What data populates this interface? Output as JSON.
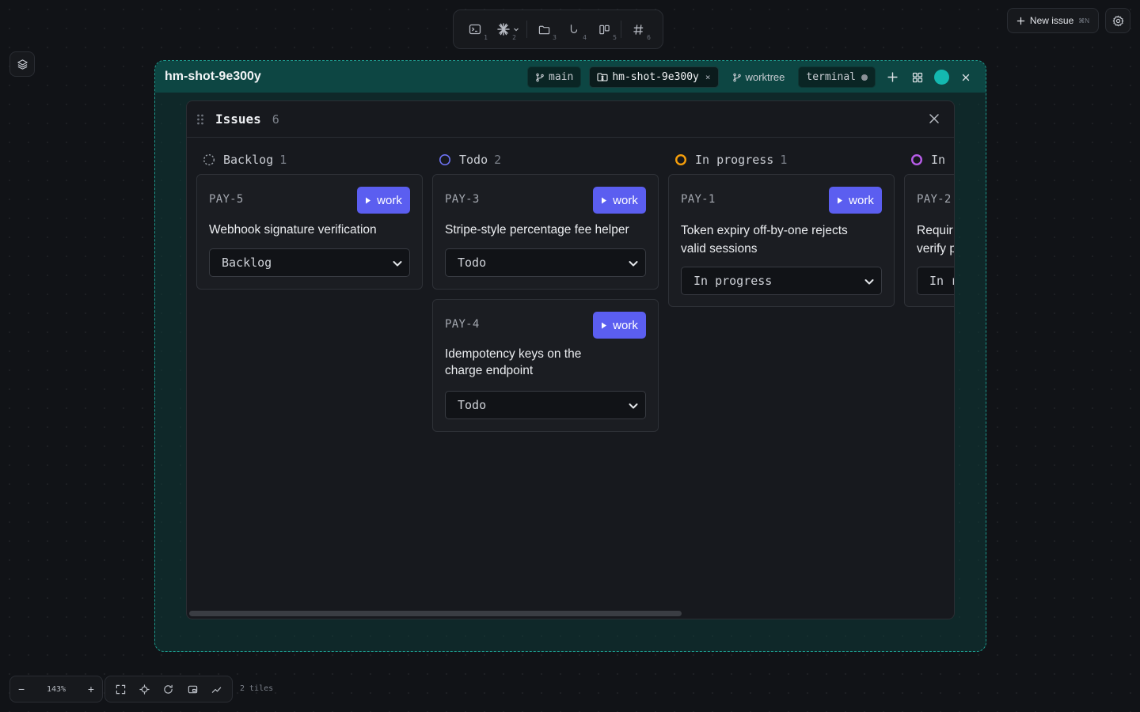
{
  "toolbar": {
    "buttons": [
      {
        "icon": "terminal-icon",
        "num": "1"
      },
      {
        "icon": "asterisk-icon",
        "num": "2"
      },
      {
        "icon": "folder-icon",
        "num": "3"
      },
      {
        "icon": "hook-icon",
        "num": "4"
      },
      {
        "icon": "board-icon",
        "num": "5"
      },
      {
        "icon": "hash-icon",
        "num": "6"
      }
    ]
  },
  "new_issue": {
    "label": "New issue",
    "shortcut": "⌘N"
  },
  "tile": {
    "title": "hm-shot-9e300y",
    "chips": {
      "branch": "main",
      "active_tab": "hm-shot-9e300y",
      "close_mark": "×",
      "worktree": "worktree",
      "terminal": "terminal"
    },
    "accent_color": "#1d9a8d",
    "avatar_color": "#14b8b0"
  },
  "issues_panel": {
    "title": "Issues",
    "count": "6",
    "columns": [
      {
        "name": "Backlog",
        "count": "1",
        "status_color": "#9aa0a8"
      },
      {
        "name": "Todo",
        "count": "2",
        "status_color": "#6d72f3"
      },
      {
        "name": "In progress",
        "count": "1",
        "status_color": "#f59e0b"
      },
      {
        "name": "In r",
        "count": "",
        "status_color": "#b75ce8"
      }
    ],
    "cards": [
      {
        "id": "PAY-5",
        "title": "Webhook signature verification",
        "status": "Backlog",
        "action": "work"
      },
      {
        "id": "PAY-3",
        "title": "Stripe-style percentage fee helper",
        "status": "Todo",
        "action": "work"
      },
      {
        "id": "PAY-4",
        "title": "Idempotency keys on the charge endpoint",
        "status": "Todo",
        "action": "work"
      },
      {
        "id": "PAY-1",
        "title": "Token expiry off-by-one rejects valid sessions",
        "status": "In progress",
        "action": "work"
      },
      {
        "id": "PAY-2",
        "title": "Requir verify p",
        "status": "In r",
        "action": ""
      }
    ],
    "work_button_color": "#5b5ef0"
  },
  "bottom_bar": {
    "zoom_out": "−",
    "zoom_level": "143%",
    "zoom_in": "+",
    "tiles_count": "2 tiles"
  }
}
